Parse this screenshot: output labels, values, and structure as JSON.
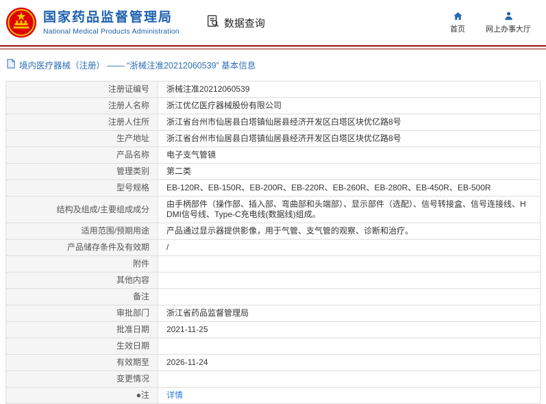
{
  "header": {
    "org_name_cn": "国家药品监督管理局",
    "org_name_en": "National Medical Products Administration",
    "nav_data_query": "数据查询",
    "nav_home": "首页",
    "nav_service_hall": "网上办事大厅"
  },
  "breadcrumb": {
    "text": "境内医疗器械（注册） —— “浙械注准20212060539” 基本信息"
  },
  "colors": {
    "brand_blue": "#1b5fae",
    "emblem_red": "#de0000",
    "divider_red": "#9e1010",
    "link_blue": "#2d7dd2",
    "label_bg": "#f5f5f5"
  },
  "table": {
    "rows": [
      {
        "label": "注册证编号",
        "value": "浙械注准20212060539"
      },
      {
        "label": "注册人名称",
        "value": "浙江优亿医疗器械股份有限公司"
      },
      {
        "label": "注册人住所",
        "value": "浙江省台州市仙居县白塔镇仙居县经济开发区白塔区块优亿路8号"
      },
      {
        "label": "生产地址",
        "value": "浙江省台州市仙居县白塔镇仙居县经济开发区白塔区块优亿路8号"
      },
      {
        "label": "产品名称",
        "value": "电子支气管镜"
      },
      {
        "label": "管理类别",
        "value": "第二类"
      },
      {
        "label": "型号规格",
        "value": "EB-120R、EB-150R、EB-200R、EB-220R、EB-260R、EB-280R、EB-450R、EB-500R"
      },
      {
        "label": "结构及组成/主要组成成分",
        "value": "由手柄部件（操作部、插入部、弯曲部和头端部）、显示部件（选配）、信号转接盒、信号连接线、HDMI信号线、Type-C充电线(数据线)组成。"
      },
      {
        "label": "适用范围/预期用途",
        "value": "产品通过显示器提供影像，用于气管、支气管的观察、诊断和治疗。"
      },
      {
        "label": "产品储存条件及有效期",
        "value": "/"
      },
      {
        "label": "附件",
        "value": ""
      },
      {
        "label": "其他内容",
        "value": ""
      },
      {
        "label": "备注",
        "value": ""
      },
      {
        "label": "审批部门",
        "value": "浙江省药品监督管理局"
      },
      {
        "label": "批准日期",
        "value": "2021-11-25"
      },
      {
        "label": "生效日期",
        "value": ""
      },
      {
        "label": "有效期至",
        "value": "2026-11-24"
      },
      {
        "label": "变更情况",
        "value": ""
      },
      {
        "label": "●注",
        "value": "详情"
      }
    ]
  }
}
